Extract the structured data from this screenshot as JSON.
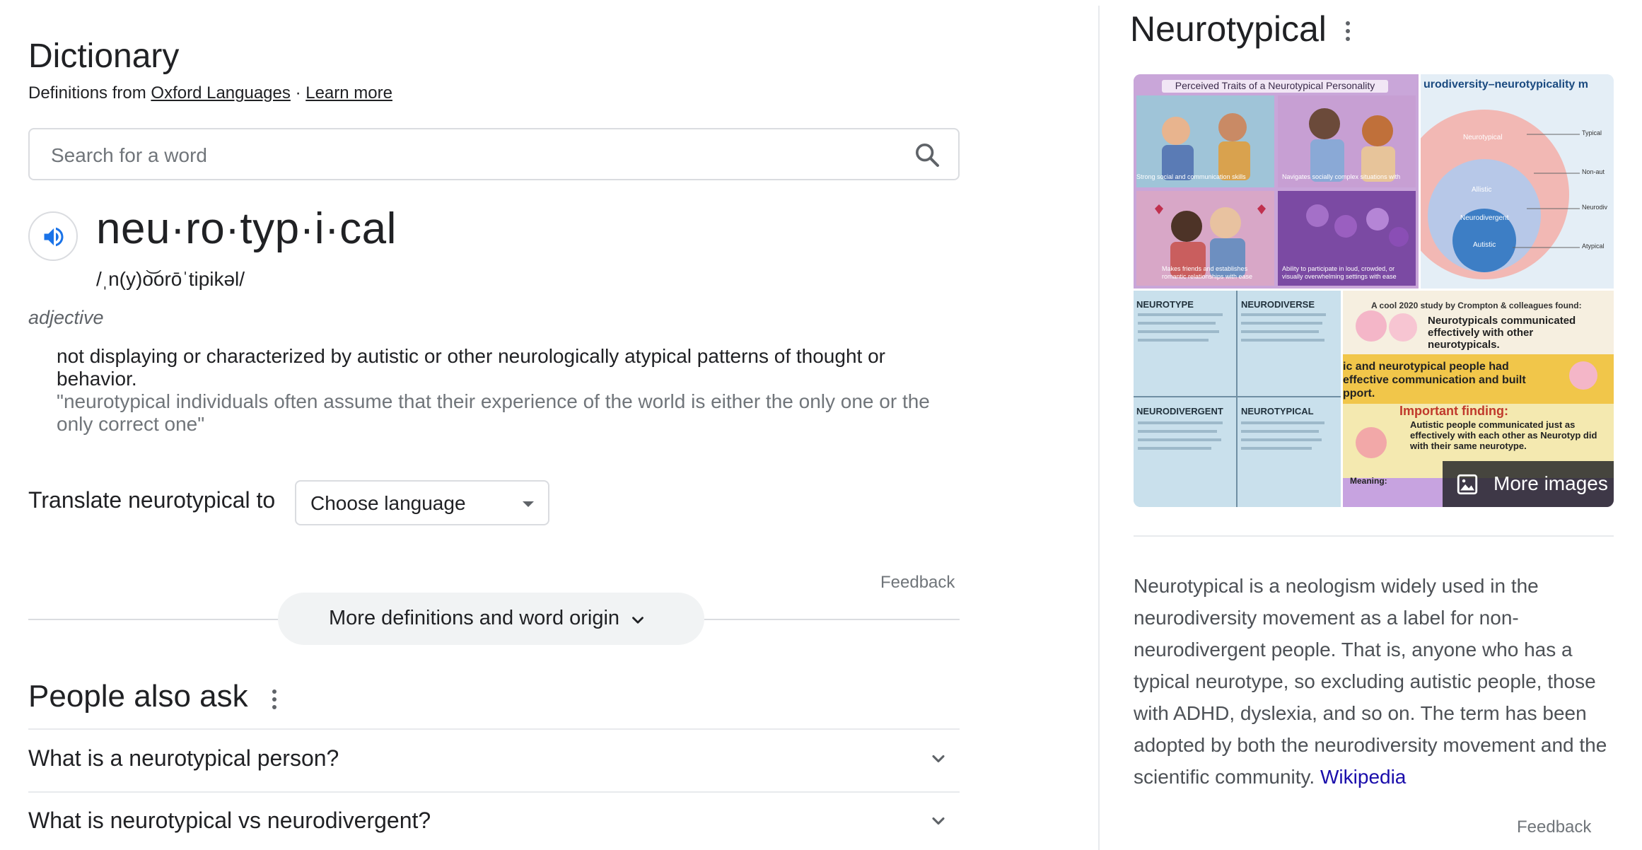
{
  "dictionary": {
    "title": "Dictionary",
    "definitions_from": "Definitions from",
    "source_link": "Oxford Languages",
    "separator": "·",
    "learn_more": "Learn more",
    "search_placeholder": "Search for a word",
    "headword": "neu·ro·typ·i·cal",
    "pronunciation": "/ˌn(y)o͝orōˈtipikəl/",
    "part_of_speech": "adjective",
    "definition": "not displaying or characterized by autistic or other neurologically atypical patterns of thought or behavior.",
    "example": "\"neurotypical individuals often assume that their experience of the world is either the only one or the only correct one\"",
    "translate_label": "Translate neurotypical to",
    "language_select": "Choose language",
    "feedback": "Feedback",
    "more_definitions": "More definitions and word origin"
  },
  "people_also_ask": {
    "title": "People also ask",
    "questions": [
      "What is a neurotypical person?",
      "What is neurotypical vs neurodivergent?"
    ]
  },
  "knowledge_panel": {
    "title": "Neurotypical",
    "more_images": "More images",
    "images": {
      "tile1_caption": "Perceived Traits of a Neurotypical Personality",
      "tile1_sub1": "Strong social and communication skills",
      "tile1_sub2": "Navigates socially complex situations with",
      "tile1_sub3": "Makes friends and establishes romantic relationships with ease",
      "tile1_sub4": "Ability to participate in loud, crowded, or visually overwhelming settings with ease",
      "tile2_caption": "urodiversity–neurotypicality m",
      "tile2_ring1": "Neurotypical",
      "tile2_ring2": "Allistic",
      "tile2_ring3": "Neurodivergent",
      "tile2_ring4": "Autistic",
      "tile2_side1": "Typical",
      "tile2_side2": "Non-aut",
      "tile2_side3": "Neurodiv",
      "tile2_side4": "Atypical",
      "tile3_h1": "NEUROTYPE",
      "tile3_h2": "NEURODIVERSE",
      "tile3_h3": "NEURODIVERGENT",
      "tile3_h4": "NEUROTYPICAL",
      "tile4_caption": "A cool 2020 study by Crompton & colleagues found:",
      "tile4_t1": "Neurotypicals communicated effectively with other neurotypicals.",
      "tile4_t2": "ic and neurotypical people had effective communication and built pport.",
      "tile4_t3": "Important finding:",
      "tile4_t4": "Autistic people communicated just as effectively with each other as Neurotyp did with their same neurotype.",
      "tile4_t5": "Meaning:"
    },
    "description": "Neurotypical is a neologism widely used in the neurodiversity movement as a label for non-neurodivergent people. That is, anyone who has a typical neurotype, so excluding autistic people, those with ADHD, dyslexia, and so on. The term has been adopted by both the neurodiversity movement and the scientific community.",
    "wiki_link": "Wikipedia",
    "feedback": "Feedback"
  }
}
